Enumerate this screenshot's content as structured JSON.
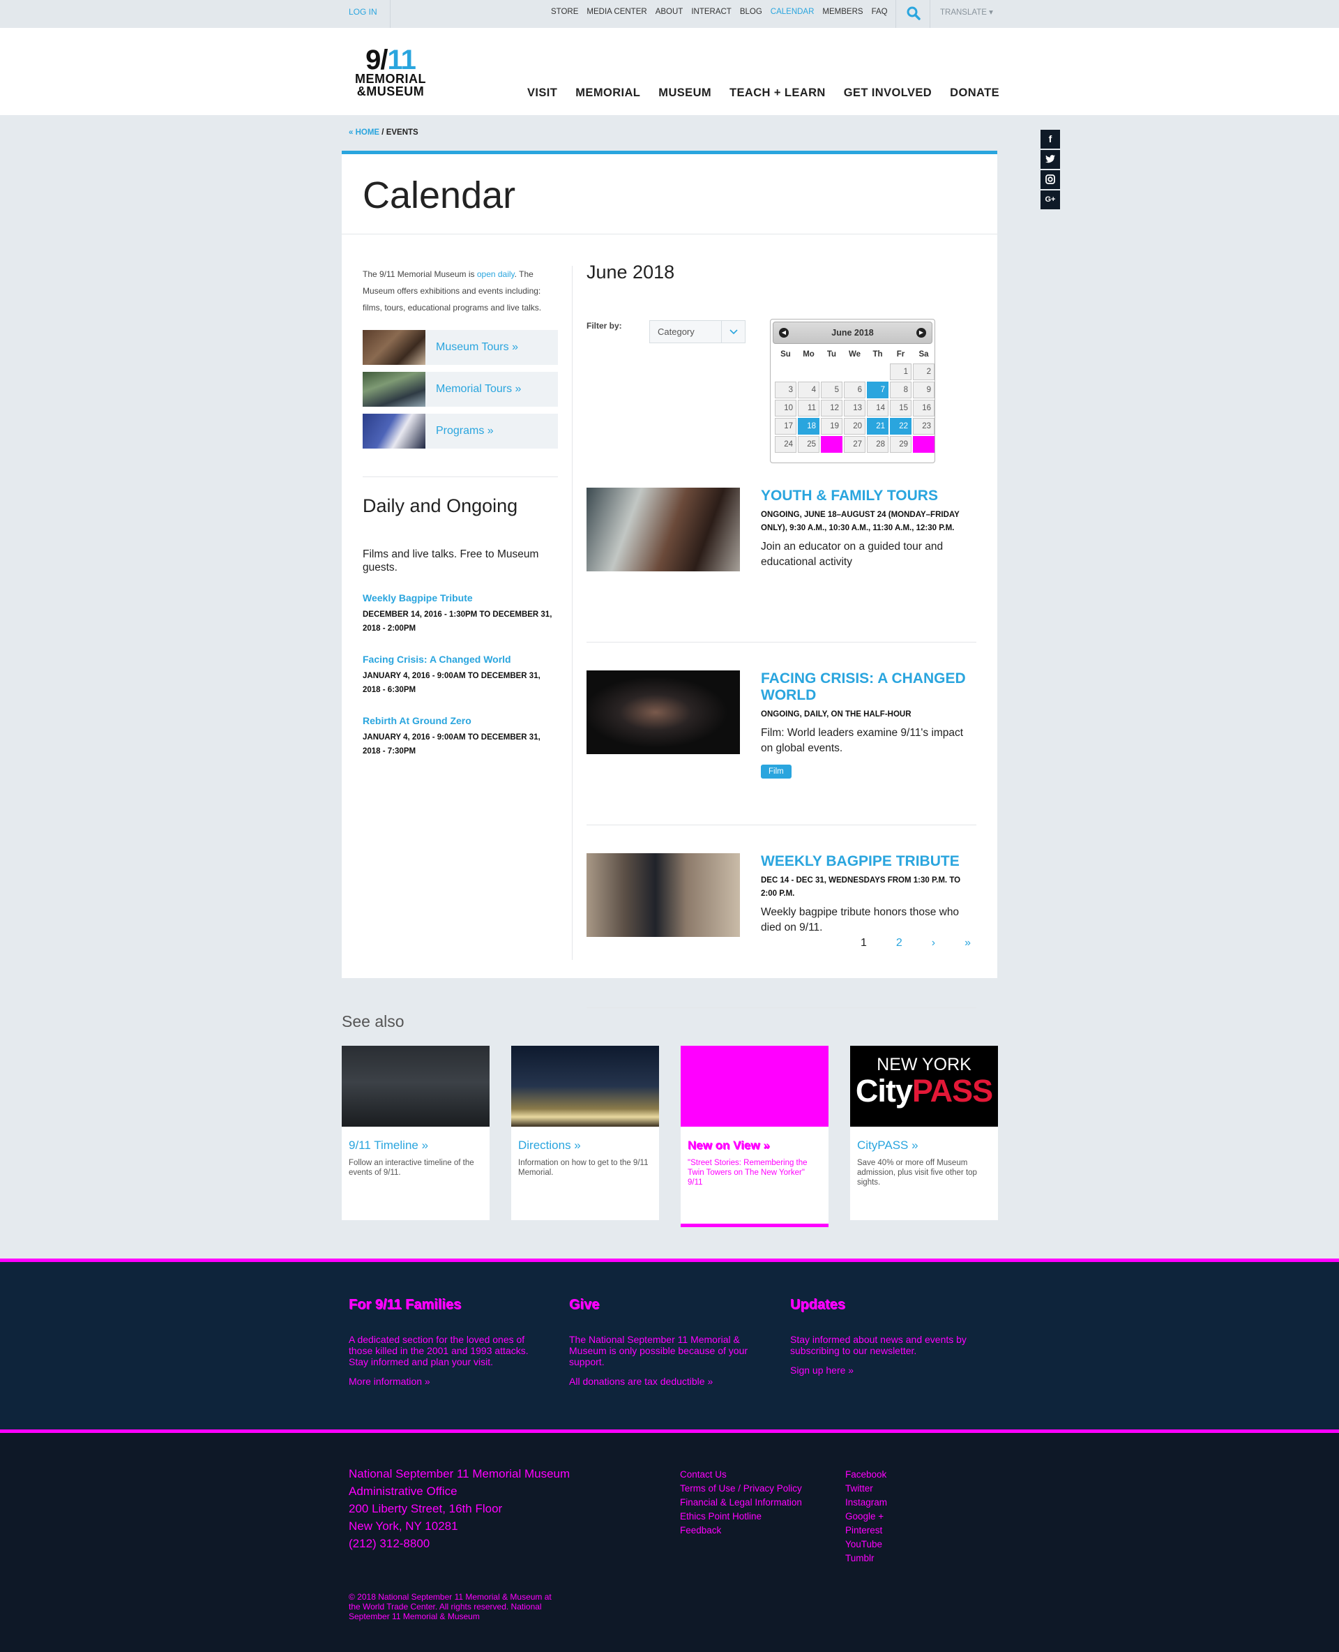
{
  "utility": {
    "login": "LOG IN",
    "links": [
      "STORE",
      "MEDIA CENTER",
      "ABOUT",
      "INTERACT",
      "BLOG",
      "CALENDAR",
      "MEMBERS",
      "FAQ"
    ],
    "active": "CALENDAR",
    "translate": "TRANSLATE ▾"
  },
  "logo": {
    "num_a": "9/",
    "num_b": "11",
    "line1": "MEMORIAL",
    "line2": "&MUSEUM"
  },
  "nav": [
    "VISIT",
    "MEMORIAL",
    "MUSEUM",
    "TEACH + LEARN",
    "GET INVOLVED",
    "DONATE"
  ],
  "breadcrumb": {
    "home": "« HOME",
    "sep": " / ",
    "current": "EVENTS"
  },
  "social": [
    "f",
    "t",
    "ig",
    "G+"
  ],
  "page_title": "Calendar",
  "intro": {
    "before": "The 9/11 Memorial Museum is ",
    "link": "open daily",
    "after": ". The Museum offers exhibitions and events including: films, tours, educational programs and live talks."
  },
  "quick_links": [
    "Museum Tours »",
    "Memorial Tours »",
    "Programs »"
  ],
  "daily": {
    "title": "Daily and Ongoing",
    "desc": "Films and live talks. Free to Museum guests.",
    "items": [
      {
        "title": "Weekly Bagpipe Tribute",
        "date": "DECEMBER 14, 2016 - 1:30PM TO DECEMBER 31, 2018 - 2:00PM"
      },
      {
        "title": "Facing Crisis: A Changed World",
        "date": "JANUARY 4, 2016 - 9:00AM TO DECEMBER 31, 2018 - 6:30PM"
      },
      {
        "title": "Rebirth At Ground Zero",
        "date": "JANUARY 4, 2016 - 9:00AM TO DECEMBER 31, 2018 - 7:30PM"
      }
    ]
  },
  "month_title": "June 2018",
  "filter": {
    "label": "Filter by:",
    "value": "Category"
  },
  "datepicker": {
    "title": "June 2018",
    "prev": "◀",
    "next": "▶",
    "dow": [
      "Su",
      "Mo",
      "Tu",
      "We",
      "Th",
      "Fr",
      "Sa"
    ],
    "days": [
      {
        "d": "",
        "s": "empty"
      },
      {
        "d": "",
        "s": "empty"
      },
      {
        "d": "",
        "s": "empty"
      },
      {
        "d": "",
        "s": "empty"
      },
      {
        "d": "",
        "s": "empty"
      },
      {
        "d": "1",
        "s": ""
      },
      {
        "d": "2",
        "s": ""
      },
      {
        "d": "3",
        "s": ""
      },
      {
        "d": "4",
        "s": ""
      },
      {
        "d": "5",
        "s": ""
      },
      {
        "d": "6",
        "s": ""
      },
      {
        "d": "7",
        "s": "hl"
      },
      {
        "d": "8",
        "s": ""
      },
      {
        "d": "9",
        "s": ""
      },
      {
        "d": "10",
        "s": ""
      },
      {
        "d": "11",
        "s": ""
      },
      {
        "d": "12",
        "s": ""
      },
      {
        "d": "13",
        "s": ""
      },
      {
        "d": "14",
        "s": ""
      },
      {
        "d": "15",
        "s": ""
      },
      {
        "d": "16",
        "s": ""
      },
      {
        "d": "17",
        "s": ""
      },
      {
        "d": "18",
        "s": "hl"
      },
      {
        "d": "19",
        "s": ""
      },
      {
        "d": "20",
        "s": ""
      },
      {
        "d": "21",
        "s": "hl"
      },
      {
        "d": "22",
        "s": "hl"
      },
      {
        "d": "23",
        "s": ""
      },
      {
        "d": "24",
        "s": ""
      },
      {
        "d": "25",
        "s": ""
      },
      {
        "d": "",
        "s": "mg"
      },
      {
        "d": "27",
        "s": ""
      },
      {
        "d": "28",
        "s": ""
      },
      {
        "d": "29",
        "s": ""
      },
      {
        "d": "",
        "s": "mg"
      }
    ]
  },
  "events": [
    {
      "title": "YOUTH & FAMILY TOURS",
      "meta": "ONGOING, JUNE 18–AUGUST 24 (MONDAY–FRIDAY ONLY), 9:30 A.M., 10:30 A.M., 11:30 A.M., 12:30 P.M.",
      "desc": "Join an educator on a guided tour and educational activity",
      "tag": ""
    },
    {
      "title": "FACING CRISIS: A CHANGED WORLD",
      "meta": "ONGOING, DAILY, ON THE HALF-HOUR",
      "desc": "Film: World leaders examine 9/11's impact on global events.",
      "tag": "Film"
    },
    {
      "title": "WEEKLY BAGPIPE TRIBUTE",
      "meta": "DEC 14 - DEC 31, WEDNESDAYS FROM 1:30 P.M. TO 2:00 P.M.",
      "desc": "Weekly bagpipe tribute honors those who died on 9/11.",
      "tag": ""
    }
  ],
  "pager": [
    "1",
    "2",
    "›",
    "»"
  ],
  "see_also": {
    "title": "See also",
    "cards": [
      {
        "title": "9/11 Timeline »",
        "desc": "Follow an interactive timeline of the events of 9/11."
      },
      {
        "title": "Directions »",
        "desc": "Information on how to get to the 9/11 Memorial."
      },
      {
        "title": "New on View »",
        "desc": "\"Street Stories: Remembering the Twin Towers on The New Yorker\" 9/11"
      },
      {
        "title": "CityPASS »",
        "desc": "Save 40% or more off Museum admission, plus visit five other top sights.",
        "img_top": "NEW YORK",
        "img_city": "City",
        "img_pass": "PASS"
      }
    ]
  },
  "footer": {
    "cols": [
      {
        "h": "For 9/11 Families",
        "p": "A dedicated section for the loved ones of those killed in the 2001 and 1993 attacks. Stay informed and plan your visit.",
        "m": "More information »"
      },
      {
        "h": "Give",
        "p": "The National September 11 Memorial & Museum is only possible because of your support.",
        "m": "All donations are tax deductible »"
      },
      {
        "h": "Updates",
        "p": "Stay informed about news and events by subscribing to our newsletter.",
        "m": "Sign up here »"
      }
    ],
    "address": [
      "National September 11 Memorial Museum",
      "Administrative Office",
      "200 Liberty Street, 16th Floor",
      "New York, NY 10281",
      "(212) 312-8800"
    ],
    "links": [
      "Contact Us",
      "Terms of Use / Privacy Policy",
      "Financial & Legal Information",
      "Ethics Point Hotline",
      "Feedback"
    ],
    "social": [
      "Facebook",
      "Twitter",
      "Instagram",
      "Google +",
      "Pinterest",
      "YouTube",
      "Tumblr"
    ],
    "copyright": "© 2018 National September 11 Memorial & Museum at the World Trade Center. All rights reserved. National September 11 Memorial & Museum"
  }
}
